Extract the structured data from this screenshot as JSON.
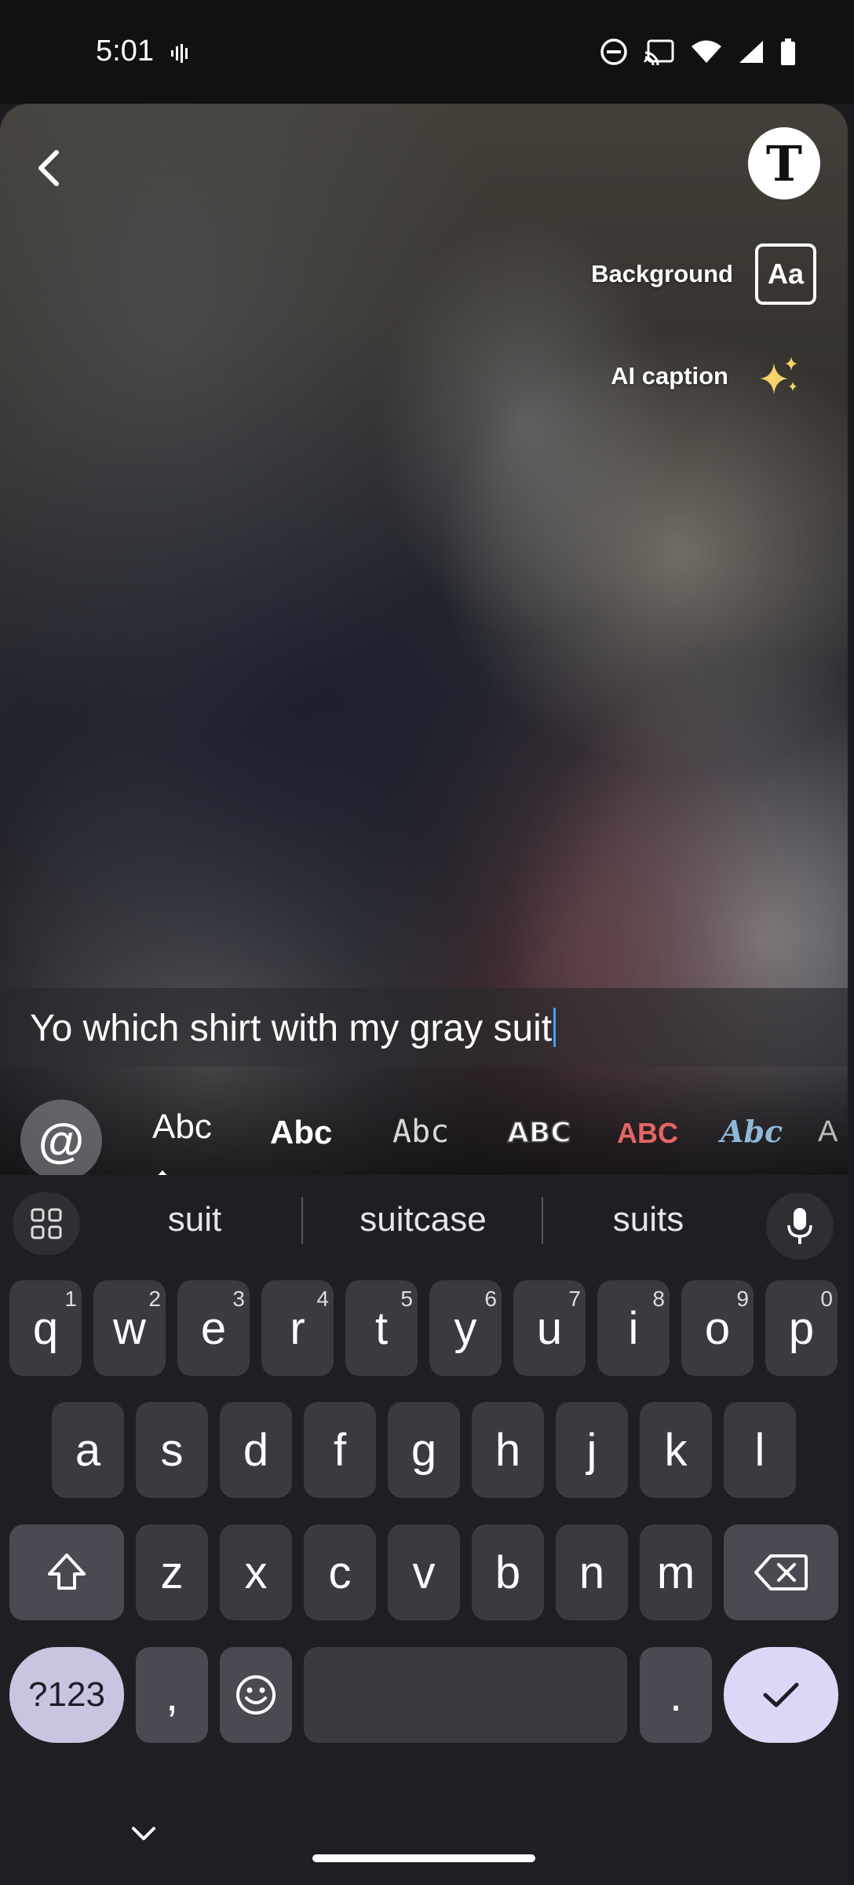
{
  "status_bar": {
    "time": "5:01",
    "icons": [
      "voice-activity-icon",
      "do-not-disturb-icon",
      "cast-icon",
      "wifi-icon",
      "signal-icon",
      "battery-icon"
    ]
  },
  "editor": {
    "top_button_text": "T",
    "background_label": "Background",
    "background_icon_text": "Aa",
    "ai_caption_label": "AI caption",
    "caption_text": "Yo which shirt with my gray suit"
  },
  "font_styles": {
    "mention_symbol": "@",
    "options": [
      "Abc",
      "Abc",
      "Abc",
      "ABC",
      "ABC",
      "Abc",
      "A"
    ],
    "selected_index": 0
  },
  "keyboard": {
    "suggestions": [
      "suit",
      "suitcase",
      "suits"
    ],
    "row1": [
      {
        "key": "q",
        "hint": "1"
      },
      {
        "key": "w",
        "hint": "2"
      },
      {
        "key": "e",
        "hint": "3"
      },
      {
        "key": "r",
        "hint": "4"
      },
      {
        "key": "t",
        "hint": "5"
      },
      {
        "key": "y",
        "hint": "6"
      },
      {
        "key": "u",
        "hint": "7"
      },
      {
        "key": "i",
        "hint": "8"
      },
      {
        "key": "o",
        "hint": "9"
      },
      {
        "key": "p",
        "hint": "0"
      }
    ],
    "row2": [
      "a",
      "s",
      "d",
      "f",
      "g",
      "h",
      "j",
      "k",
      "l"
    ],
    "row3": [
      "z",
      "x",
      "c",
      "v",
      "b",
      "n",
      "m"
    ],
    "symbols_label": "?123",
    "comma": ",",
    "period": "."
  },
  "colors": {
    "accent_caret": "#4a9eff",
    "enter_key": "#dcd6f7",
    "symbols_key": "#c9c5e0"
  }
}
